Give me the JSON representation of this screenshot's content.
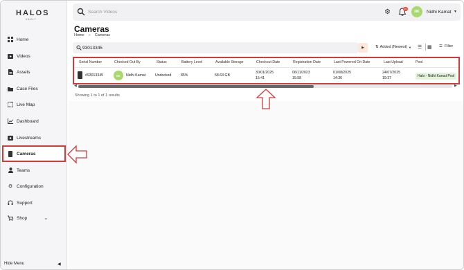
{
  "brand": {
    "name": "HALOS",
    "sub": "VAULT"
  },
  "sidebar": {
    "items": [
      {
        "label": "Home",
        "icon": "grid-icon"
      },
      {
        "label": "Videos",
        "icon": "video-icon"
      },
      {
        "label": "Assets",
        "icon": "file-icon"
      },
      {
        "label": "Case Files",
        "icon": "folder-icon"
      },
      {
        "label": "Live Map",
        "icon": "map-icon"
      },
      {
        "label": "Dashboard",
        "icon": "chart-icon"
      },
      {
        "label": "Livestreams",
        "icon": "broadcast-icon"
      },
      {
        "label": "Cameras",
        "icon": "camera-device-icon",
        "active": true
      },
      {
        "label": "Teams",
        "icon": "person-icon"
      },
      {
        "label": "Configuration",
        "icon": "gear-icon"
      },
      {
        "label": "Support",
        "icon": "headset-icon"
      },
      {
        "label": "Shop",
        "icon": "cart-icon"
      }
    ],
    "hide_menu": "Hide Menu"
  },
  "topbar": {
    "search_placeholder": "Search Videos",
    "notification_count": "10",
    "user_initials": "NK",
    "user_name": "Nidhi Kamat"
  },
  "page": {
    "title": "Cameras",
    "breadcrumb": [
      "Home",
      "Cameras"
    ]
  },
  "filters": {
    "search_value": "93013345",
    "sort_label": "Added (Newest)",
    "filter_label": "Filter"
  },
  "table": {
    "columns": [
      "Serial Number",
      "Checked Out By",
      "Status",
      "Battery Level",
      "Available Storage",
      "Checkout Date",
      "Registration Date",
      "Last Powered On Date",
      "Last Upload",
      "Pool"
    ],
    "rows": [
      {
        "serial": "#93013345",
        "checked_out_by": "Nidhi Kamat",
        "initials": "NK",
        "status": "Undocked",
        "battery": "85%",
        "storage": "58.63 GB",
        "checkout_date": "30/01/2025",
        "checkout_time": "15:41",
        "registration_date": "06/11/2023",
        "registration_time": "15:58",
        "last_powered_date": "01/08/2025",
        "last_powered_time": "14:36",
        "last_upload_date": "24/07/2025",
        "last_upload_time": "19:37",
        "pool": "Halo - Nidhi Kamat Pool"
      }
    ],
    "results_text": "Showing 1 to 1 of 1 results"
  },
  "colors": {
    "accent_red": "#d23a3a",
    "avatar_green": "#a9d86e",
    "pool_chip": "#e2f3da",
    "go_button": "#ffe8d9"
  }
}
